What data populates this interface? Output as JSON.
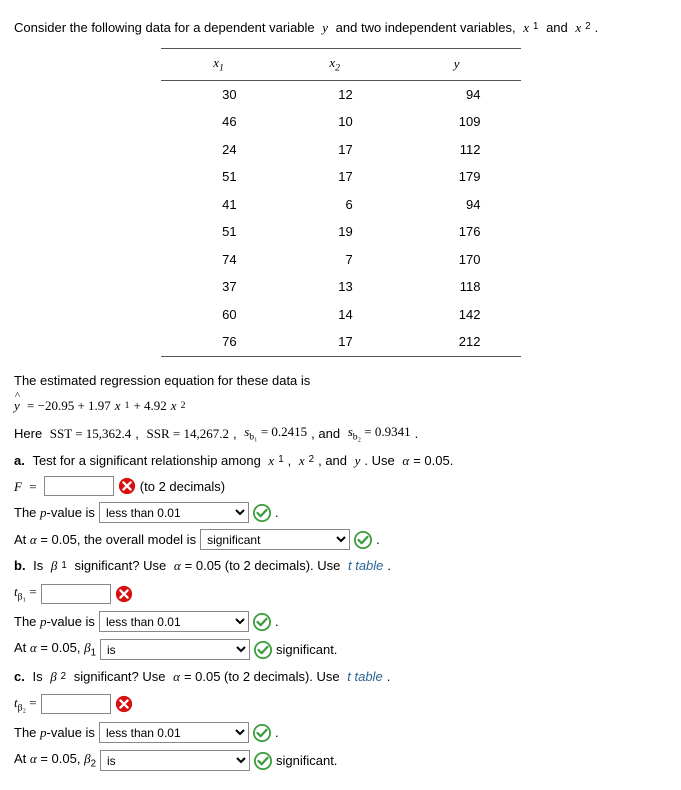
{
  "intro": "Consider the following data for a dependent variable y and two independent variables, x₁ and x₂.",
  "table": {
    "headers": [
      "x₁",
      "x₂",
      "y"
    ],
    "rows": [
      [
        "30",
        "12",
        "94"
      ],
      [
        "46",
        "10",
        "109"
      ],
      [
        "24",
        "17",
        "112"
      ],
      [
        "51",
        "17",
        "179"
      ],
      [
        "41",
        "6",
        "94"
      ],
      [
        "51",
        "19",
        "176"
      ],
      [
        "74",
        "7",
        "170"
      ],
      [
        "37",
        "13",
        "118"
      ],
      [
        "60",
        "14",
        "142"
      ],
      [
        "76",
        "17",
        "212"
      ]
    ]
  },
  "eq_intro": "The estimated regression equation for these data is",
  "equation": "ŷ = −20.95 + 1.97x₁ + 4.92x₂",
  "here_line_pre": "Here ",
  "sst_lbl": "SST = 15,362.4",
  "ssr_lbl": "SSR = 14,267.2",
  "sb1_lbl": "s_{b₁} = 0.2415",
  "sb2_lbl": "s_{b₂} = 0.9341",
  "part_a": "a. Test for a significant relationship among x₁, x₂, and y. Use α = 0.05.",
  "F_lbl": "F =",
  "to2dec": "(to 2 decimals)",
  "pvalue_pre": "The p-value is",
  "pvalue_sel": "less than 0.01",
  "period": ".",
  "at_alpha_model_pre": "At α = 0.05, the overall model is",
  "sig_sel": "significant",
  "part_b_pre": "b. Is β₁ significant? Use α = 0.05 (to 2 decimals). Use ",
  "ttable": "t table",
  "tb1_lbl": "t_{β₁} =",
  "at_alpha_b1_pre": "At α = 0.05, β₁",
  "is_sel": "is",
  "sig_word": "significant.",
  "part_c_pre": "c. Is β₂ significant? Use α = 0.05 (to 2 decimals). Use ",
  "tb2_lbl": "t_{β₂} =",
  "at_alpha_b2_pre": "At α = 0.05, β₂"
}
